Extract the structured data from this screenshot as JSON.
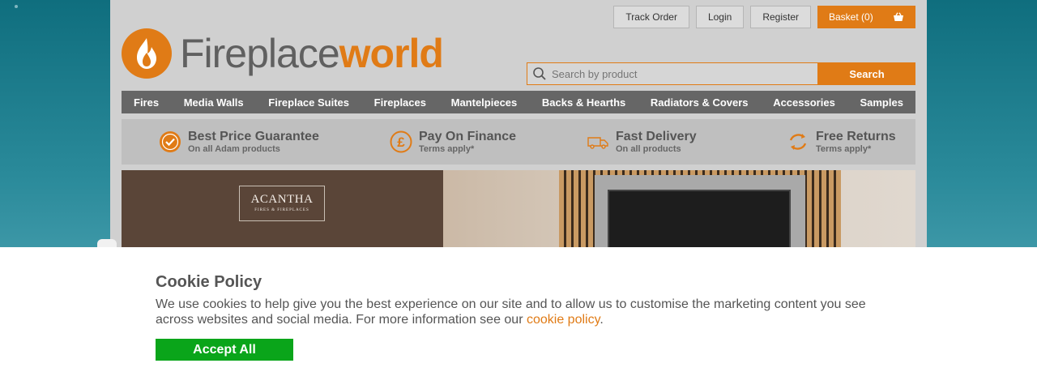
{
  "header": {
    "links": [
      "Track Order",
      "Login",
      "Register"
    ],
    "basket_label": "Basket (0)",
    "logo": {
      "part1": "Fireplace",
      "part2": "world"
    },
    "search": {
      "placeholder": "Search by product",
      "button": "Search"
    }
  },
  "nav": [
    "Fires",
    "Media Walls",
    "Fireplace Suites",
    "Fireplaces",
    "Mantelpieces",
    "Backs & Hearths",
    "Radiators & Covers",
    "Accessories",
    "Samples"
  ],
  "usps": [
    {
      "title": "Best Price Guarantee",
      "sub": "On all Adam products",
      "icon": "checkmark-circle-icon"
    },
    {
      "title": "Pay On Finance",
      "sub": "Terms apply*",
      "icon": "pound-icon"
    },
    {
      "title": "Fast Delivery",
      "sub": "On all products",
      "icon": "van-icon"
    },
    {
      "title": "Free Returns",
      "sub": "Terms apply*",
      "icon": "refresh-icon"
    }
  ],
  "hero": {
    "brand": "ACANTHA",
    "brand_sub": "FIRES & FIREPLACES"
  },
  "cookie": {
    "title": "Cookie Policy",
    "text": "We use cookies to help give you the best experience on our site and to allow us to customise the marketing content you see across websites and social media. For more information see our ",
    "link": "cookie policy",
    "text_end": ".",
    "accept": "Accept All"
  },
  "colors": {
    "accent": "#e07b16",
    "nav": "#666666",
    "accept": "#0aa51a"
  }
}
